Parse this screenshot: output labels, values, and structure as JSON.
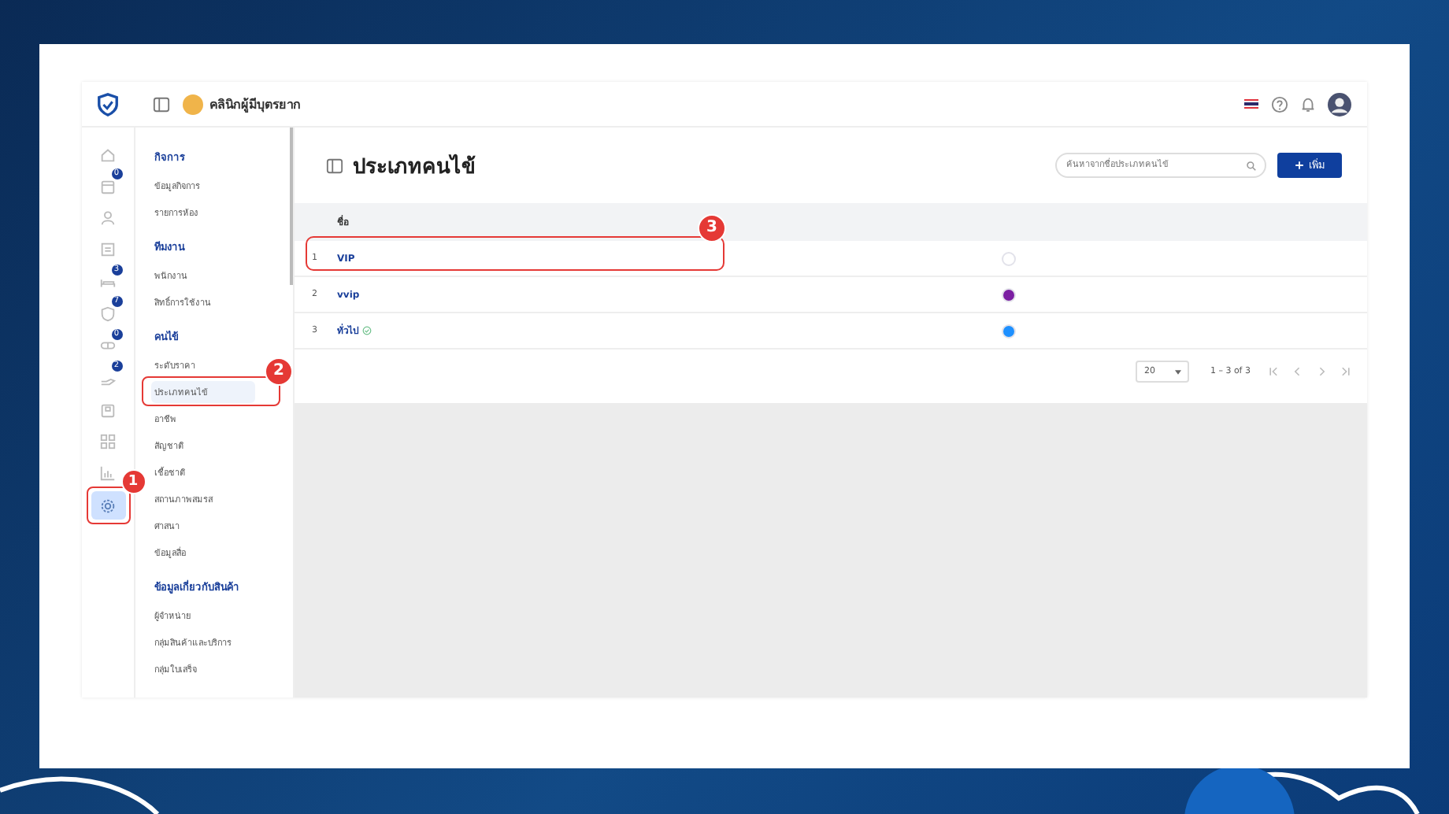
{
  "header": {
    "clinic_name": "คลินิกผู้มีบุตรยาก"
  },
  "rail": [
    {
      "selected": false
    },
    {
      "selected": false,
      "badge": "0"
    },
    {
      "selected": false
    },
    {
      "selected": false
    },
    {
      "selected": false,
      "badge": "3"
    },
    {
      "selected": false,
      "badge": "7"
    },
    {
      "selected": false,
      "badge": "0"
    },
    {
      "selected": false,
      "badge": "2"
    },
    {
      "selected": false
    },
    {
      "selected": false
    },
    {
      "selected": false
    },
    {
      "selected": true,
      "annotation": "1"
    }
  ],
  "sidebar": {
    "sections": [
      {
        "title": "กิจการ",
        "items": [
          {
            "label": "ข้อมูลกิจการ",
            "selected": false
          },
          {
            "label": "รายการห้อง",
            "selected": false
          }
        ]
      },
      {
        "title": "ทีมงาน",
        "items": [
          {
            "label": "พนักงาน",
            "selected": false
          },
          {
            "label": "สิทธิ์การใช้งาน",
            "selected": false
          }
        ]
      },
      {
        "title": "คนไข้",
        "items": [
          {
            "label": "ระดับราคา",
            "selected": false
          },
          {
            "label": "ประเภทคนไข้",
            "selected": true,
            "annotation": "2"
          },
          {
            "label": "อาชีพ",
            "selected": false
          },
          {
            "label": "สัญชาติ",
            "selected": false
          },
          {
            "label": "เชื้อชาติ",
            "selected": false
          },
          {
            "label": "สถานภาพสมรส",
            "selected": false
          },
          {
            "label": "ศาสนา",
            "selected": false
          },
          {
            "label": "ข้อมูลสื่อ",
            "selected": false
          }
        ]
      },
      {
        "title": "ข้อมูลเกี่ยวกับสินค้า",
        "items": [
          {
            "label": "ผู้จำหน่าย",
            "selected": false
          },
          {
            "label": "กลุ่มสินค้าและบริการ",
            "selected": false
          },
          {
            "label": "กลุ่มใบเสร็จ",
            "selected": false
          }
        ]
      }
    ]
  },
  "page": {
    "title": "ประเภทคนไข้",
    "search": {
      "placeholder": "ค้นหาจากชื่อประเภทคนไข้"
    },
    "add_button": "เพิ่ม"
  },
  "table": {
    "columns": [
      "ชื่อ"
    ],
    "rows": [
      {
        "index": "1",
        "name": "VIP",
        "color": "#ffffff",
        "default": false,
        "annotation": "3"
      },
      {
        "index": "2",
        "name": "vvip",
        "color": "#7b1fa2",
        "default": false
      },
      {
        "index": "3",
        "name": "ทั่วไป",
        "color": "#1e90ff",
        "default": true
      }
    ]
  },
  "pagination": {
    "page_size": "20",
    "range": "1 – 3 of 3"
  }
}
